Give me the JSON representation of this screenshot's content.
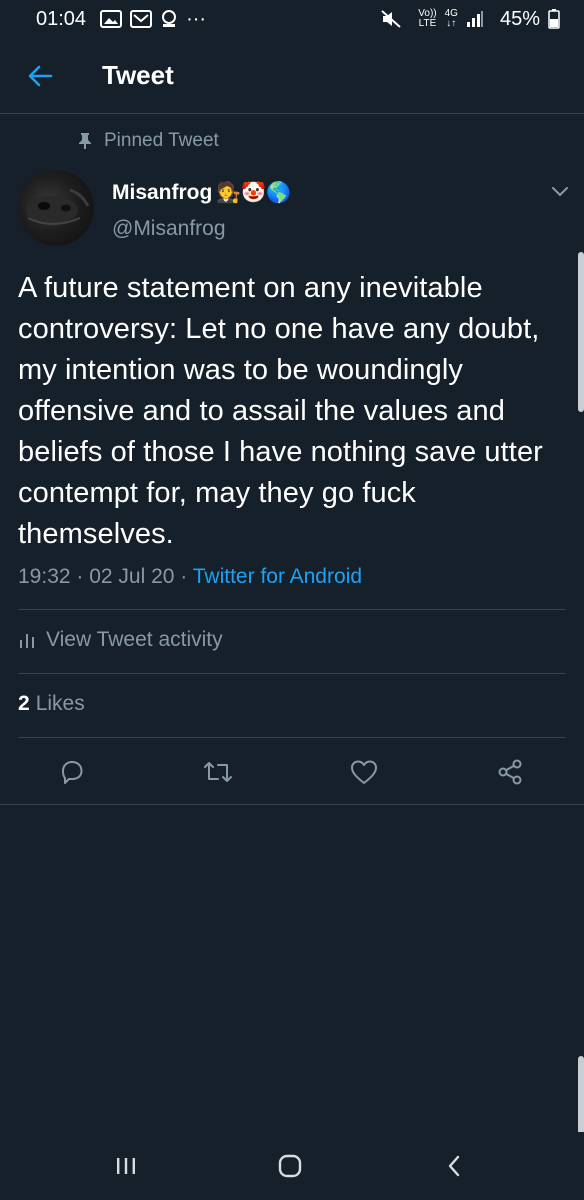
{
  "status_bar": {
    "time": "01:04",
    "more": "···",
    "volte_line1": "Vo))",
    "volte_line2": "LTE",
    "net_line1": "4G",
    "net_line2": "↓↑",
    "battery": "45%"
  },
  "header": {
    "back_icon": "arrow-left-icon",
    "title": "Tweet"
  },
  "pinned": {
    "icon": "pin-icon",
    "label": "Pinned Tweet"
  },
  "author": {
    "name": "Misanfrog",
    "emojis": "🧑‍⚖️🤡🌎",
    "handle": "@Misanfrog"
  },
  "tweet": {
    "text": "A future statement on any inevitable controversy: Let no one have any doubt, my intention was to be woundingly offensive and to assail the values and beliefs of those I have nothing save utter contempt for, may they go fuck themselves.",
    "time": "19:32",
    "sep1": " · ",
    "date": "02 Jul 20",
    "sep2": " · ",
    "source": "Twitter for Android"
  },
  "activity": {
    "icon": "bar-chart-icon",
    "label": "View Tweet activity"
  },
  "likes": {
    "count": "2",
    "label": "Likes"
  },
  "actions": [
    "reply-icon",
    "retweet-icon",
    "like-icon",
    "share-icon"
  ],
  "colors": {
    "background": "#15202b",
    "divider": "#38444d",
    "secondary_text": "#8899a6",
    "accent": "#1da1f2"
  }
}
